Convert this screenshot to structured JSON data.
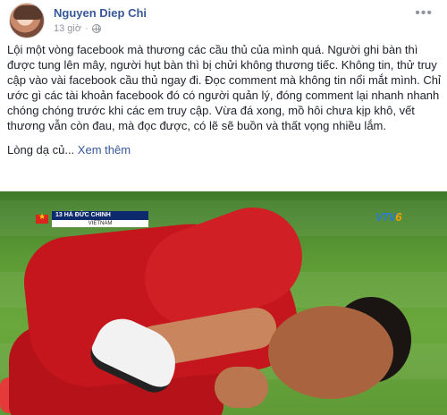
{
  "post": {
    "author": "Nguyen Diep Chi",
    "time": "13 giờ",
    "privacy_icon": "globe-icon",
    "menu_icon": "more-icon",
    "paragraph1": "Lội một vòng facebook mà thương các cầu thủ của mình quá. Người ghi bàn thì được tung lên mây, người hụt bàn thì bị chửi không thương tiếc. Không tin, thử truy cập vào vài facebook cầu thủ ngay đi. Đọc comment mà không tin nổi mắt mình. Chỉ ước gì các tài khoản facebook đó có người quản lý, đóng comment lại nhanh nhanh chóng chóng trước khi các em truy cập. Vừa đá xong, mồ hôi chưa kịp khô, vết thương vẫn còn đau, mà đọc được, có lẽ sẽ buồn và thất vọng nhiều lắm.",
    "paragraph2": "Lòng dạ củ...",
    "see_more": "Xem thêm"
  },
  "photo": {
    "scorebug_player": "13 HÀ ĐỨC CHINH",
    "scorebug_team": "VIETNAM",
    "channel_logo_text": "VTV",
    "channel_logo_number": "6",
    "colors": {
      "jersey": "#c4161c",
      "pitch": "#5c9a35",
      "bug": "#0d2a6e",
      "channel": "#2d7bd1"
    }
  }
}
